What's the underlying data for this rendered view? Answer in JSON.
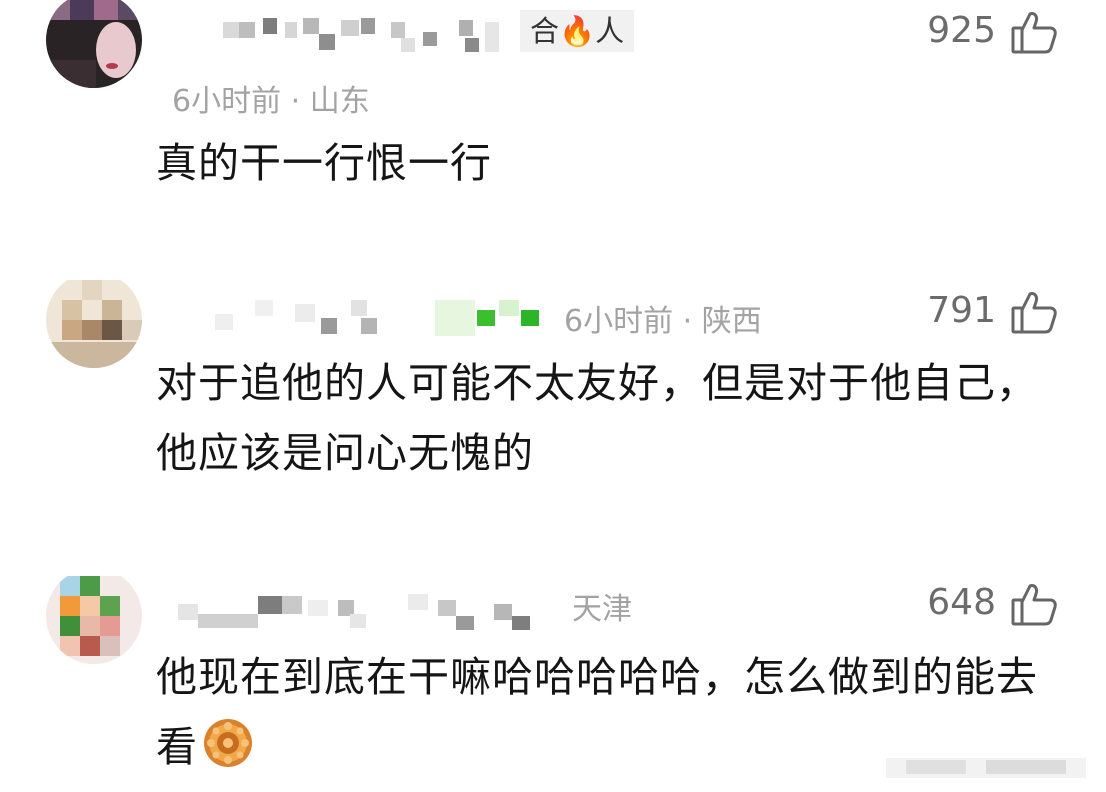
{
  "comments": [
    {
      "badge": "合🔥人",
      "meta": "6小时前 · 山东",
      "likes": "925",
      "text": "真的干一行恨一行"
    },
    {
      "meta": "6小时前 · 陕西",
      "likes": "791",
      "text": "对于追他的人可能不太友好，但是对于他自己，他应该是问心无愧的"
    },
    {
      "meta": "天津",
      "likes": "648",
      "text": "他现在到底在干嘛哈哈哈哈哈，怎么做到的能去看"
    }
  ],
  "icons": {
    "like": "thumbs-up-icon",
    "emoji": "mooncake-emoji-icon"
  },
  "colors": {
    "meta": "#a3a3a3",
    "text": "#151515",
    "likes": "#6b6b6b"
  }
}
